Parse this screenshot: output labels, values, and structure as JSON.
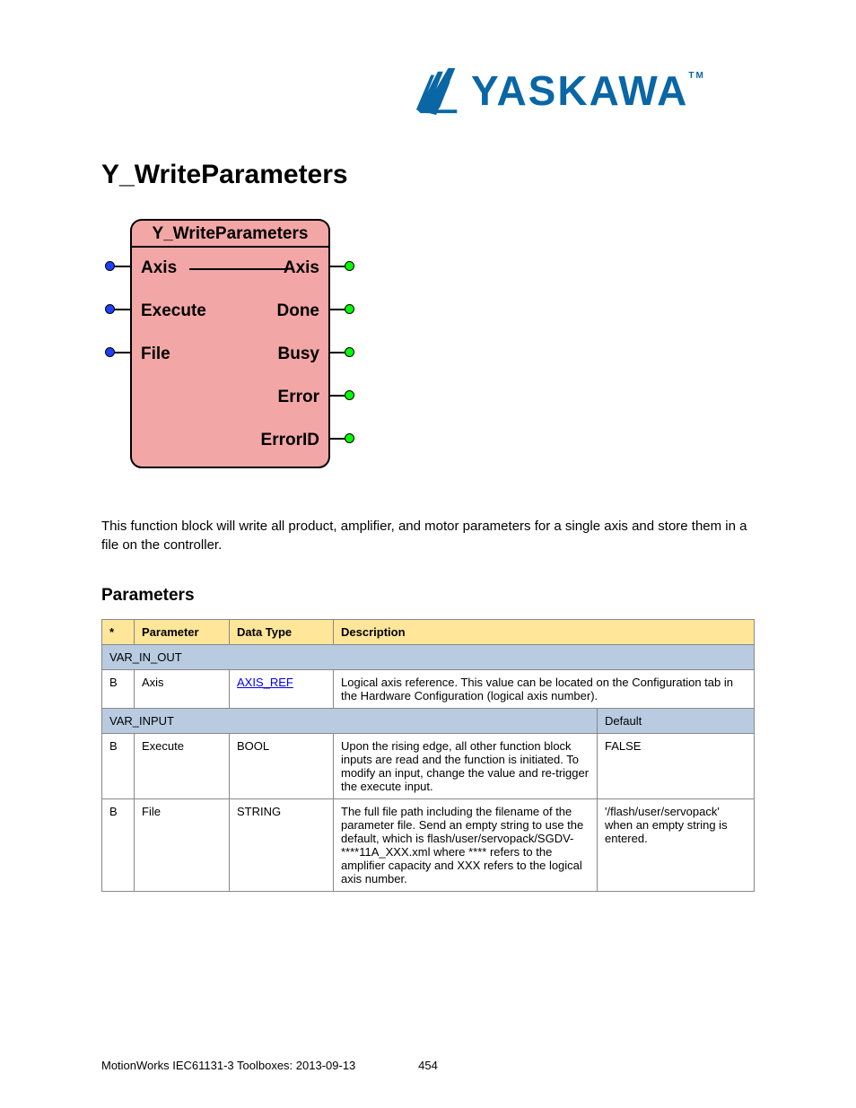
{
  "logo": {
    "text": "YASKAWA",
    "tm": "TM"
  },
  "title": "Y_WriteParameters",
  "fb": {
    "name": "Y_WriteParameters",
    "inputs": [
      "Axis",
      "Execute",
      "File"
    ],
    "outputs": [
      "Axis",
      "Done",
      "Busy",
      "Error",
      "ErrorID"
    ]
  },
  "description": "This function block will write all product, amplifier, and motor parameters for a single axis and store them in a file on the controller.",
  "params_heading": "Parameters",
  "table": {
    "headers": [
      "*",
      "Parameter",
      "Data Type",
      "Description"
    ],
    "section_var_in_out": "VAR_IN_OUT",
    "row_axis": {
      "bv": "B",
      "param": "Axis",
      "type": "AXIS_REF",
      "desc": "Logical axis reference. This value can be located on the Configuration tab in the Hardware Configuration (logical axis number)."
    },
    "section_var_input": {
      "label": "VAR_INPUT",
      "default": "Default"
    },
    "row_execute": {
      "bv": "B",
      "param": "Execute",
      "type": "BOOL",
      "desc": "Upon the rising edge, all other function block inputs are read and the function is initiated. To modify an input, change the value and re-trigger the execute input.",
      "default": "FALSE"
    },
    "row_file": {
      "bv": "B",
      "param": "File",
      "type": "STRING",
      "desc": "The full file path including the filename of the parameter file. Send an empty string to use the default, which is flash/user/servopack/SGDV-****11A_XXX.xml where **** refers to the amplifier capacity and XXX refers to the logical axis number.",
      "default": "'/flash/user/servopack' when an empty string is entered."
    }
  },
  "footer": {
    "left": "MotionWorks IEC61131-3 Toolboxes: 2013-09-13",
    "center": "454"
  }
}
